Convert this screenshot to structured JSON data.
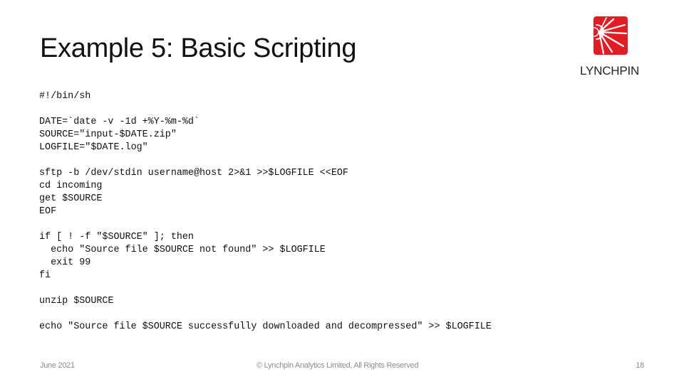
{
  "slide": {
    "title": "Example 5: Basic Scripting",
    "logo": {
      "icon": "lynchpin-sunburst-logo-icon",
      "text": "LYNCHPIN",
      "brand_color": "#e31b23"
    },
    "code_lines": [
      "#!/bin/sh",
      "",
      "DATE=`date -v -1d +%Y-%m-%d`",
      "SOURCE=\"input-$DATE.zip\"",
      "LOGFILE=\"$DATE.log\"",
      "",
      "sftp -b /dev/stdin username@host 2>&1 >>$LOGFILE <<EOF",
      "cd incoming",
      "get $SOURCE",
      "EOF",
      "",
      "if [ ! -f \"$SOURCE\" ]; then",
      "  echo \"Source file $SOURCE not found\" >> $LOGFILE",
      "  exit 99",
      "fi",
      "",
      "unzip $SOURCE",
      "",
      "echo \"Source file $SOURCE successfully downloaded and decompressed\" >> $LOGFILE"
    ],
    "footer": {
      "date": "June 2021",
      "copyright": "© Lynchpin Analytics Limited, All Rights Reserved",
      "page_number": "18"
    }
  }
}
